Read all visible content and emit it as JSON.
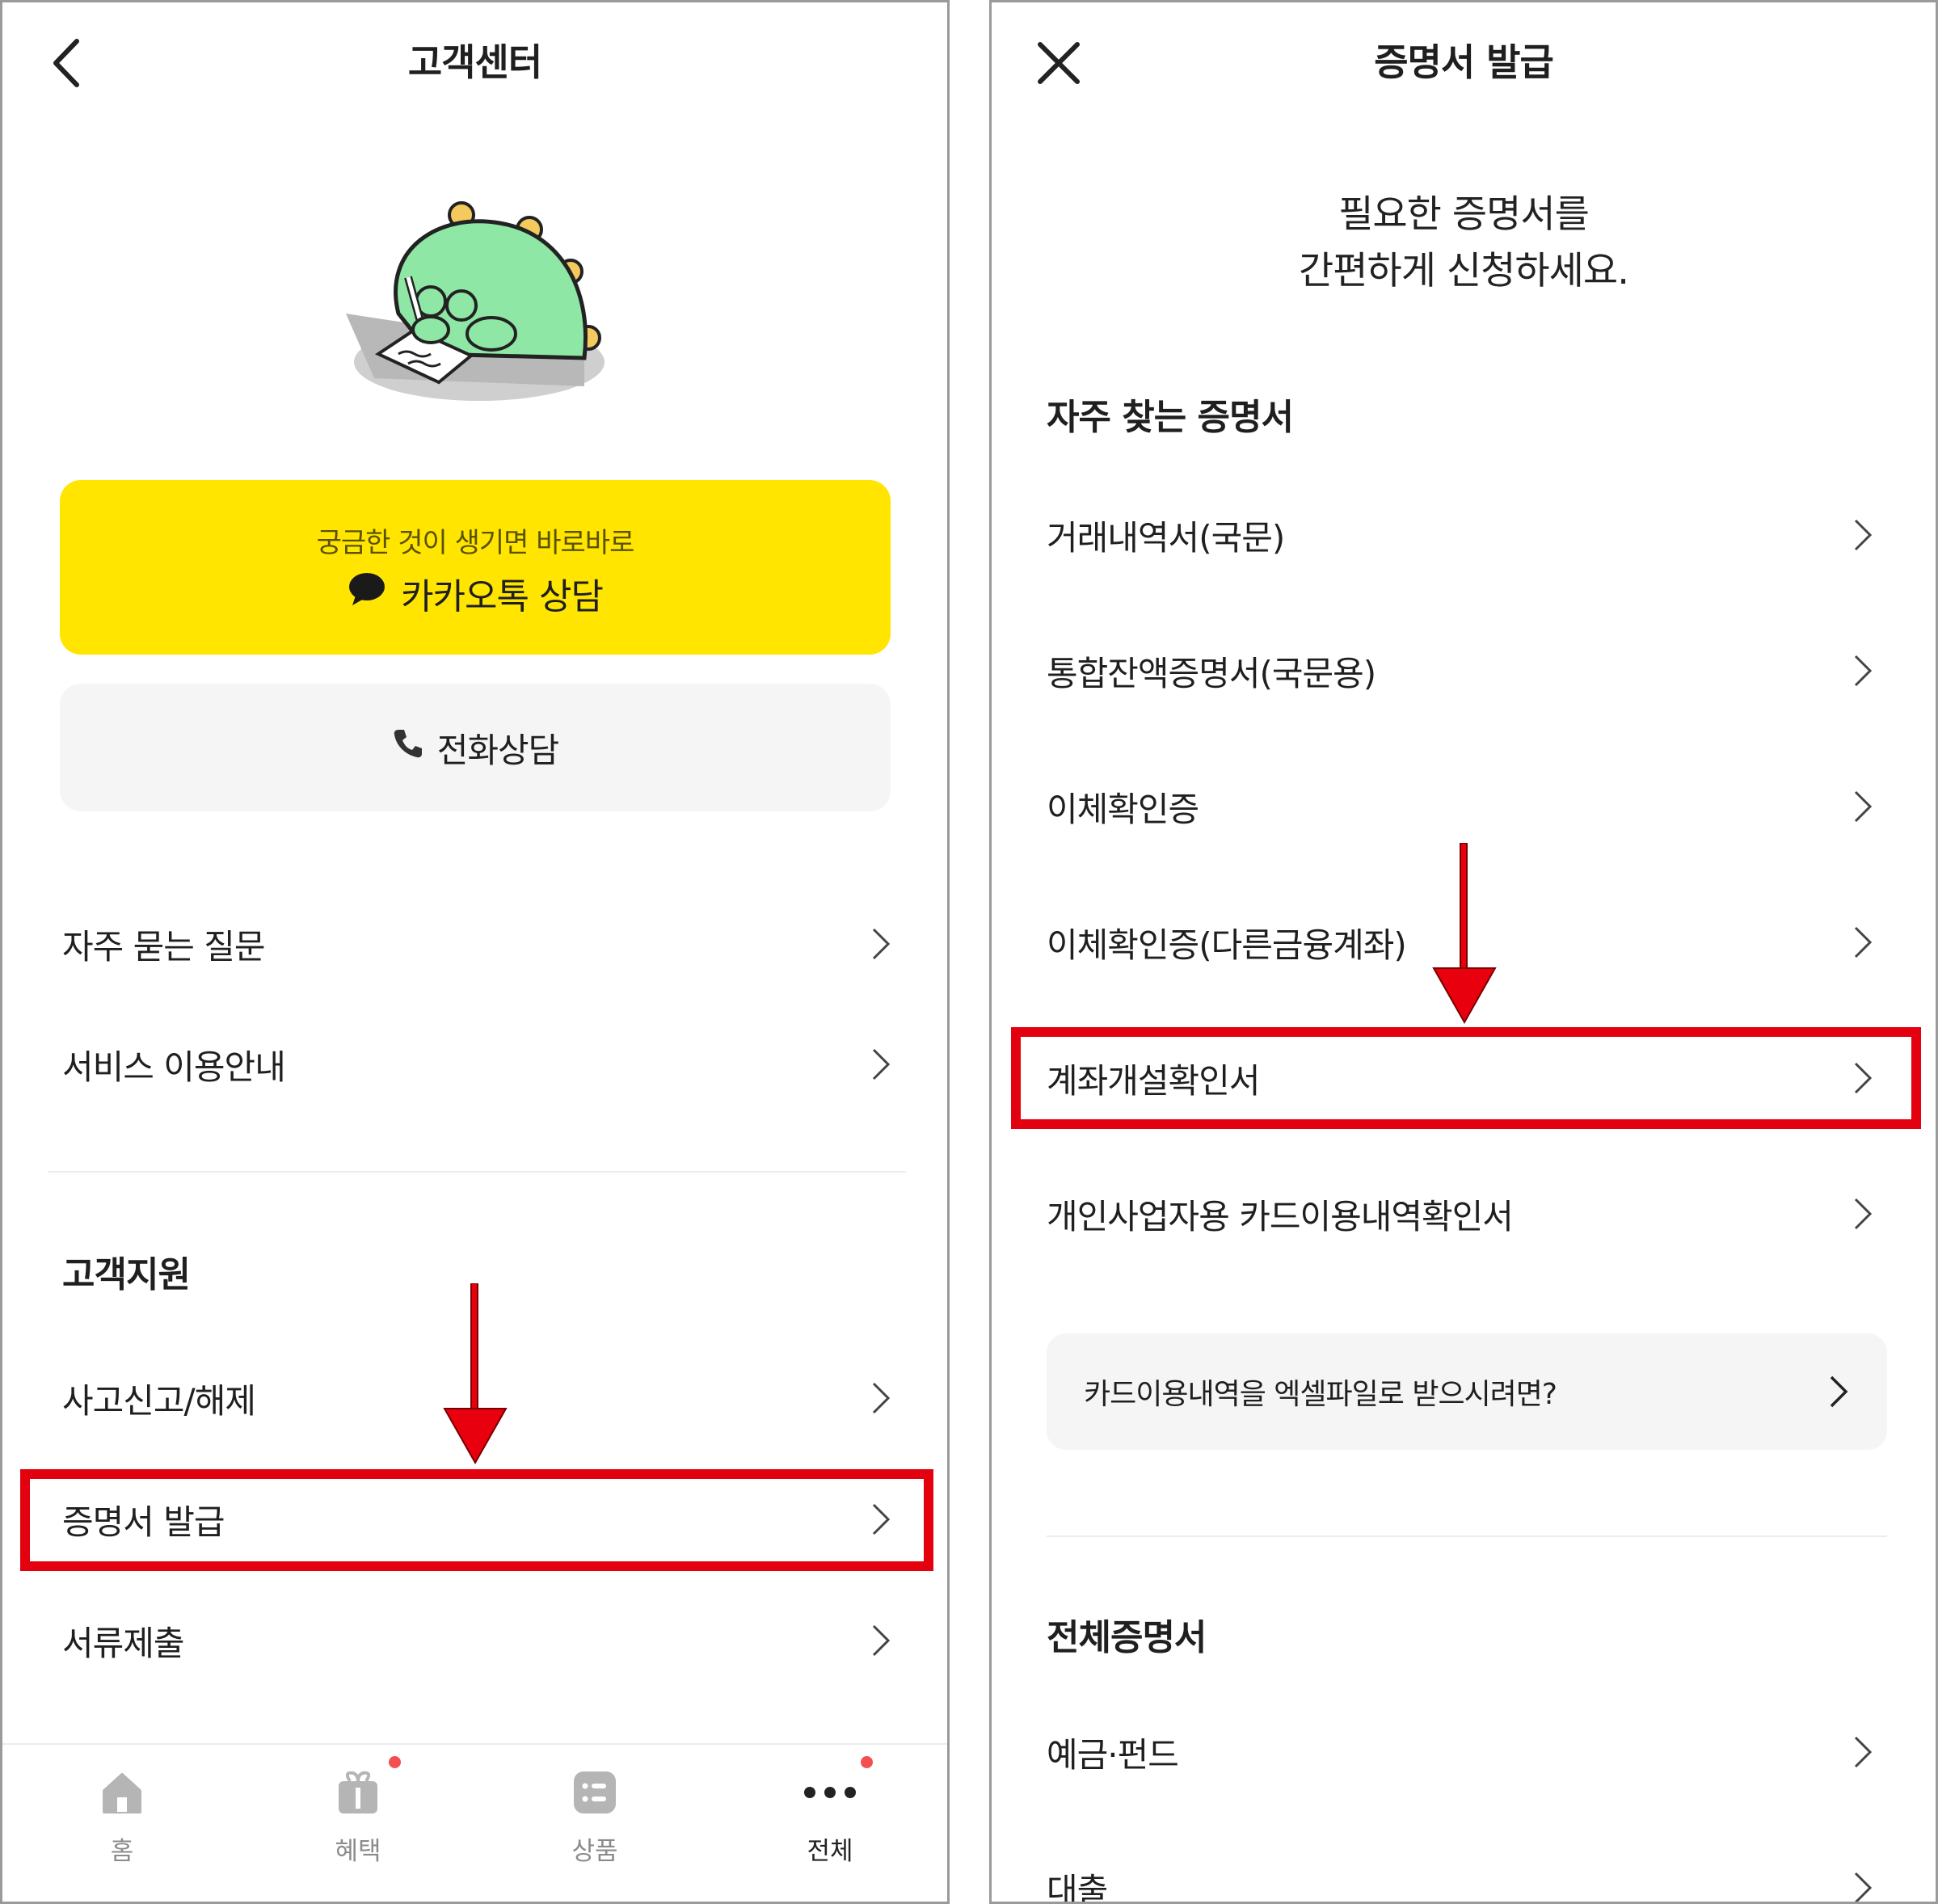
{
  "left": {
    "header": {
      "title": "고객센터"
    },
    "kakao": {
      "subtitle": "궁금한 것이 생기면 바로바로",
      "label": "카카오톡 상담"
    },
    "phone": {
      "label": "전화상담"
    },
    "menu": [
      {
        "label": "자주 묻는 질문"
      },
      {
        "label": "서비스 이용안내"
      }
    ],
    "support": {
      "title": "고객지원",
      "items": [
        {
          "label": "사고신고/해제"
        },
        {
          "label": "증명서 발급"
        },
        {
          "label": "서류제출"
        }
      ]
    },
    "bottom_nav": [
      {
        "label": "홈"
      },
      {
        "label": "혜택"
      },
      {
        "label": "상품"
      },
      {
        "label": "전체"
      }
    ]
  },
  "right": {
    "header": {
      "title": "증명서 발급"
    },
    "intro": {
      "line1": "필요한 증명서를",
      "line2": "간편하게 신청하세요."
    },
    "frequent": {
      "title": "자주 찾는 증명서",
      "items": [
        {
          "label": "거래내역서(국문)"
        },
        {
          "label": "통합잔액증명서(국문용)"
        },
        {
          "label": "이체확인증"
        },
        {
          "label": "이체확인증(다른금융계좌)"
        },
        {
          "label": "계좌개설확인서"
        },
        {
          "label": "개인사업자용 카드이용내역확인서"
        }
      ]
    },
    "excel_link": {
      "label": "카드이용내역을 엑셀파일로 받으시려면?"
    },
    "all": {
      "title": "전체증명서",
      "items": [
        {
          "label": "예금·펀드"
        },
        {
          "label": "대출"
        }
      ]
    }
  },
  "colors": {
    "kakao_yellow": "#ffe500",
    "highlight_red": "#e3000f",
    "arrow_red": "#e8000f",
    "badge_red": "#f25050",
    "mascot_green": "#8fe7a6"
  },
  "icons": [
    "back-arrow-icon",
    "close-icon",
    "chat-bubble-icon",
    "phone-icon",
    "chevron-right-icon",
    "home-icon",
    "gift-icon",
    "list-icon",
    "more-icon"
  ]
}
